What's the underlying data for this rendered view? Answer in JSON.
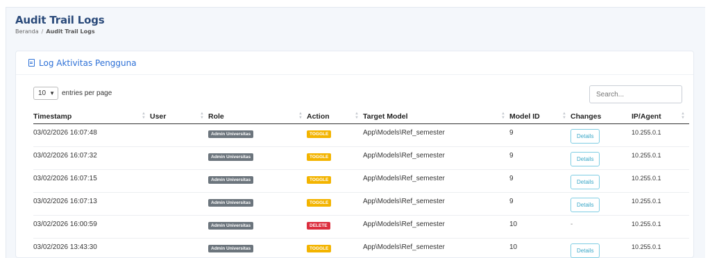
{
  "page": {
    "title": "Audit Trail Logs",
    "breadcrumb": [
      {
        "label": "Beranda"
      },
      {
        "label": "Audit Trail Logs"
      }
    ]
  },
  "card": {
    "title": "Log Aktivitas Pengguna"
  },
  "controls": {
    "length_value": "10",
    "length_suffix": "entries per page",
    "search_placeholder": "Search..."
  },
  "table": {
    "columns": [
      "Timestamp",
      "User",
      "Role",
      "Action",
      "Target Model",
      "Model ID",
      "Changes",
      "IP/Agent"
    ],
    "rows": [
      {
        "timestamp": "03/02/2026 16:07:48",
        "user": "",
        "role": "Admin Universitas",
        "action": "TOGGLE",
        "target": "App\\Models\\Ref_semester",
        "model_id": "9",
        "changes": "Details",
        "ip": "10.255.0.1"
      },
      {
        "timestamp": "03/02/2026 16:07:32",
        "user": "",
        "role": "Admin Universitas",
        "action": "TOGGLE",
        "target": "App\\Models\\Ref_semester",
        "model_id": "9",
        "changes": "Details",
        "ip": "10.255.0.1"
      },
      {
        "timestamp": "03/02/2026 16:07:15",
        "user": "",
        "role": "Admin Universitas",
        "action": "TOGGLE",
        "target": "App\\Models\\Ref_semester",
        "model_id": "9",
        "changes": "Details",
        "ip": "10.255.0.1"
      },
      {
        "timestamp": "03/02/2026 16:07:13",
        "user": "",
        "role": "Admin Universitas",
        "action": "TOGGLE",
        "target": "App\\Models\\Ref_semester",
        "model_id": "9",
        "changes": "Details",
        "ip": "10.255.0.1"
      },
      {
        "timestamp": "03/02/2026 16:00:59",
        "user": "",
        "role": "Admin Universitas",
        "action": "DELETE",
        "target": "App\\Models\\Ref_semester",
        "model_id": "10",
        "changes": "-",
        "ip": "10.255.0.1"
      },
      {
        "timestamp": "03/02/2026 13:43:30",
        "user": "",
        "role": "Admin Universitas",
        "action": "TOGGLE",
        "target": "App\\Models\\Ref_semester",
        "model_id": "10",
        "changes": "Details",
        "ip": "10.255.0.1"
      }
    ]
  },
  "colors": {
    "title": "#2a4a7a",
    "accent": "#2b6fd6",
    "toggle_badge": "#f3b400",
    "delete_badge": "#dc2f3f",
    "role_badge": "#6c757d",
    "details_button": "#3aa7c7"
  },
  "icons": {
    "card_title_icon": "document-icon",
    "length_dropdown": "chevron-down-icon",
    "sort": "sort-icon"
  }
}
